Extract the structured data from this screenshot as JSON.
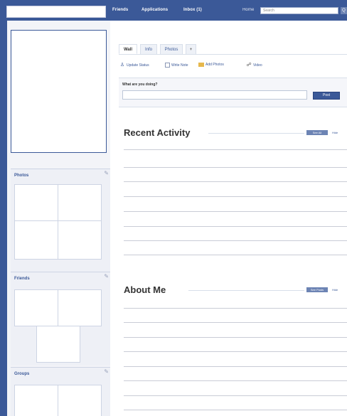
{
  "topnav": {
    "friends": "Friends",
    "applications": "Applications",
    "inbox": "Inbox (1)",
    "home": "Home",
    "search_placeholder": "Search",
    "search_button": "Q"
  },
  "sidebar": {
    "photos_title": "Photos",
    "friends_title": "Friends",
    "groups_title": "Groups"
  },
  "tabs": {
    "wall": "Wall",
    "info": "Info",
    "photos": "Photos",
    "add": "+"
  },
  "actions": {
    "update_status": "Update Status",
    "write_note": "Write Note",
    "add_photos": "Add Photos",
    "video": "Video"
  },
  "publisher": {
    "prompt": "What are you doing?",
    "post": "Post"
  },
  "sections": {
    "recent_activity": {
      "title": "Recent Activity",
      "see_all": "See All",
      "edit": "Hide"
    },
    "about_me": {
      "title": "About Me",
      "see_all": "See Posts",
      "edit": "Hide"
    }
  }
}
